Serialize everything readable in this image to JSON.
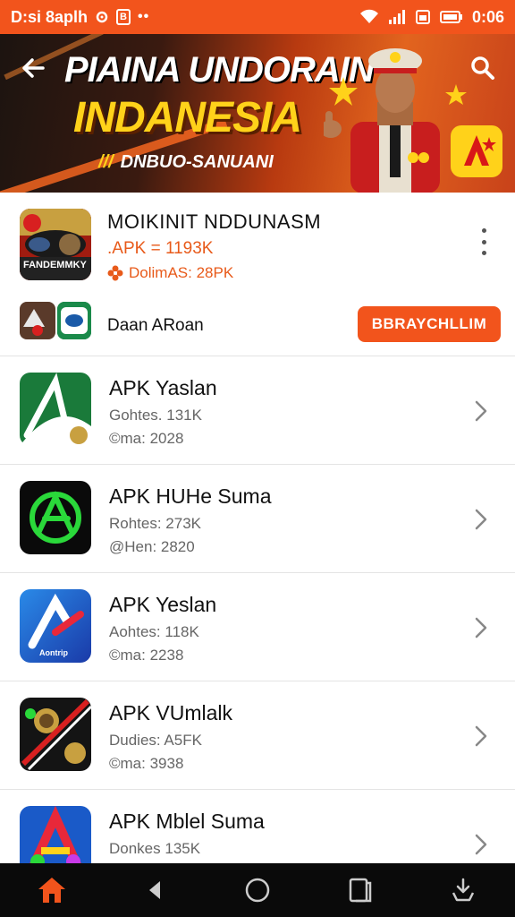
{
  "status_bar": {
    "left_text": "D:si 8aplh",
    "time": "0:06"
  },
  "banner": {
    "title_line1": "PIAINA UNDORAIN",
    "title_line2": "INDANESIA",
    "subtitle": "DNBUO-SANUANI",
    "subtitle_prefix": "///"
  },
  "featured": {
    "title": "MOIKINIT NDDUNASM",
    "size": ".APK = 1193K",
    "downloads": "DolimAS: 28PK",
    "icon_text": "FANDEMMKY",
    "secondary_name": "Daan ARoan",
    "action_label": "BBRAYCHLLIM"
  },
  "apps": [
    {
      "title": "APK Yaslan",
      "line2": "Gohtes. 131K",
      "line3": "©ma: 2028",
      "icon": "green-leaf-app-icon"
    },
    {
      "title": "APK HUHe Suma",
      "line2": "Rohtes: 273K",
      "line3": "@Hen: 2820",
      "icon": "green-logo-app-icon"
    },
    {
      "title": "APK Yeslan",
      "line2": "Aohtes: 118K",
      "line3": "©ma: 2238",
      "icon": "blue-arrow-app-icon",
      "icon_label": "Aontrip"
    },
    {
      "title": "APK VUmlalk",
      "line2": "Dudies: A5FK",
      "line3": "©ma: 3938",
      "icon": "dark-coin-app-icon"
    },
    {
      "title": "APK Mblel Suma",
      "line2": "Donkes 135K",
      "line3": "",
      "icon": "colorful-a-app-icon"
    }
  ],
  "colors": {
    "accent": "#f2541c",
    "nav_bg": "#0a0a0a",
    "home_active": "#f2541c"
  }
}
